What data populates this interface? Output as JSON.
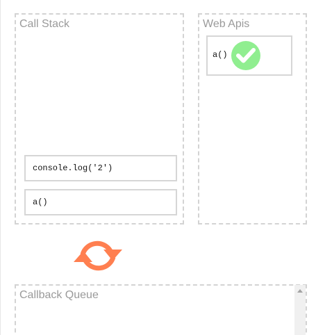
{
  "call_stack": {
    "title": "Call Stack",
    "frames": [
      {
        "label": "console.log('2')"
      },
      {
        "label": "a()"
      }
    ]
  },
  "web_apis": {
    "title": "Web Apis",
    "items": [
      {
        "label": "a()",
        "status_icon": "check-circle-icon"
      }
    ]
  },
  "event_loop": {
    "icon": "refresh-cycle-icon",
    "color": "#ff7f50"
  },
  "callback_queue": {
    "title": "Callback Queue"
  },
  "colors": {
    "panel_border": "#d3d3d3",
    "title_text": "#9a9a9a",
    "check_fill": "#90ee90"
  }
}
